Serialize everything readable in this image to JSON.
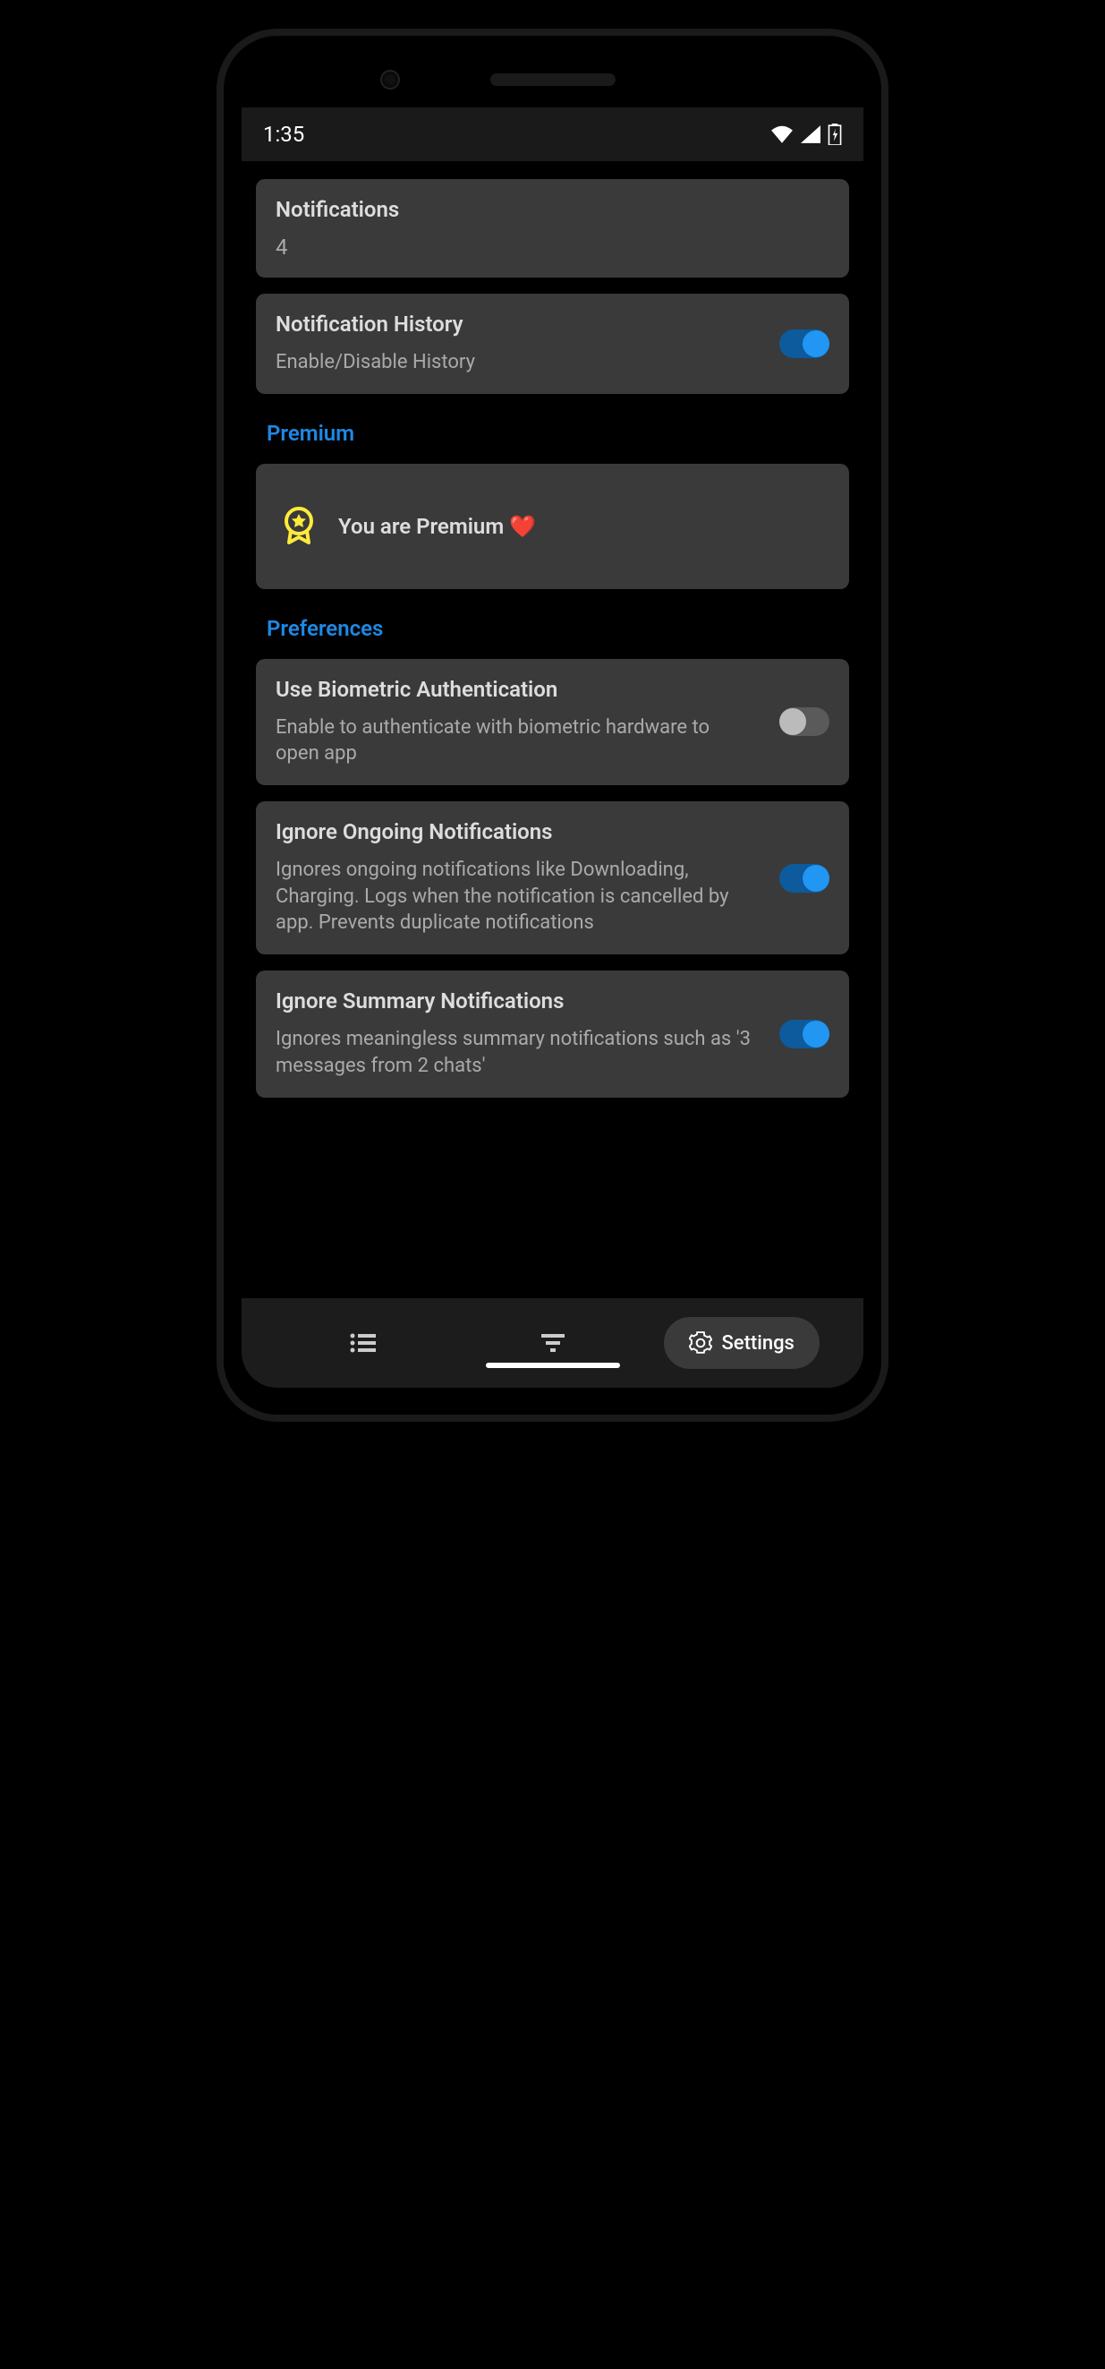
{
  "status": {
    "time": "1:35"
  },
  "cards": {
    "notifications": {
      "title": "Notifications",
      "value": "4"
    },
    "history": {
      "title": "Notification History",
      "desc": "Enable/Disable History",
      "enabled": true
    }
  },
  "sections": {
    "premium": {
      "header": "Premium",
      "badge_text": "You are Premium ❤️"
    },
    "preferences": {
      "header": "Preferences",
      "items": [
        {
          "title": "Use Biometric Authentication",
          "desc": "Enable to authenticate with biometric hardware to open app",
          "enabled": false
        },
        {
          "title": "Ignore Ongoing Notifications",
          "desc": "Ignores ongoing notifications like Downloading, Charging. Logs when the notification is cancelled by app. Prevents duplicate notifications",
          "enabled": true
        },
        {
          "title": "Ignore Summary Notifications",
          "desc": "Ignores meaningless summary notifications such as '3 messages from 2 chats'",
          "enabled": true
        }
      ]
    }
  },
  "nav": {
    "settings_label": "Settings"
  }
}
